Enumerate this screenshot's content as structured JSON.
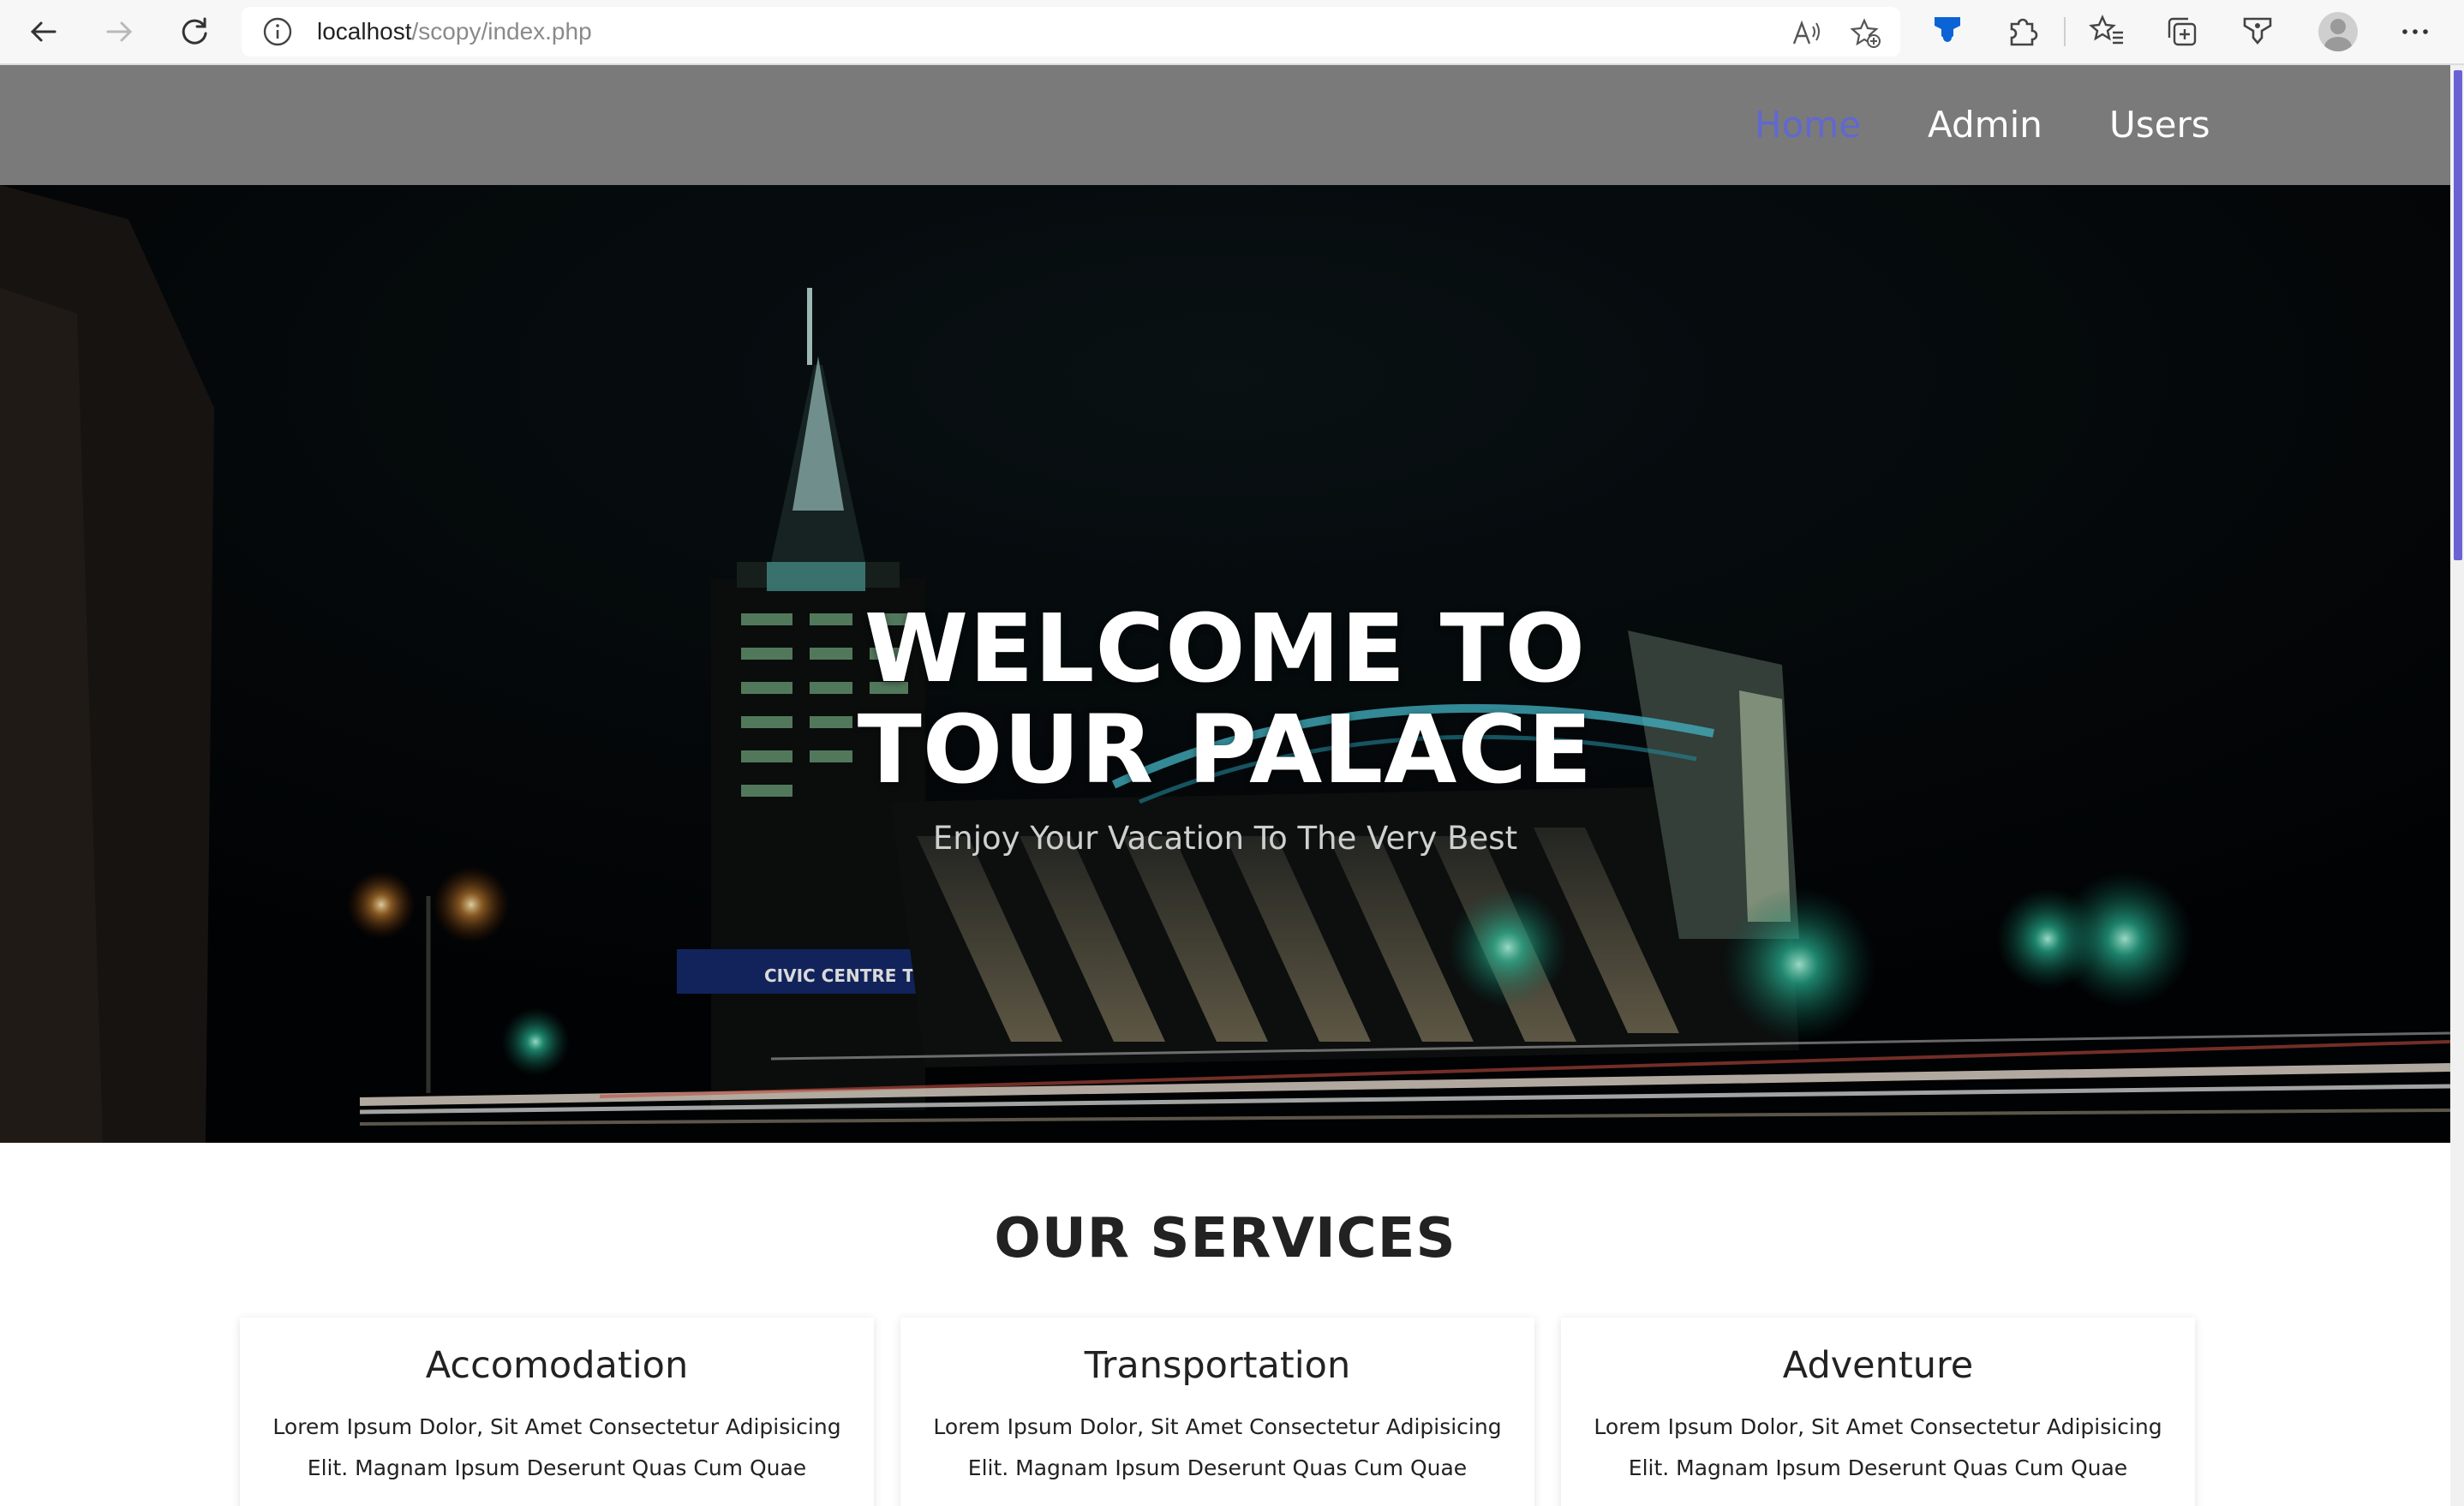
{
  "browser": {
    "url_host": "localhost",
    "url_path": "/scopy/index.php",
    "icons": [
      "back-icon",
      "forward-icon",
      "reload-icon",
      "site-info-icon",
      "read-aloud-icon",
      "add-favorite-icon",
      "extension-shield-icon",
      "extensions-icon",
      "favorites-icon",
      "collections-icon",
      "browser-essentials-icon",
      "profile-avatar-icon",
      "more-menu-icon"
    ]
  },
  "site": {
    "nav": [
      {
        "label": "Home",
        "active": true
      },
      {
        "label": "Admin",
        "active": false
      },
      {
        "label": "Users",
        "active": false
      }
    ],
    "hero": {
      "title": "WELCOME TO TOUR PALACE",
      "subtitle": "Enjoy Your Vacation To The Very Best",
      "sign_text": "CIVIC  CENTRE  TOWERS"
    },
    "services": {
      "title": "OUR SERVICES",
      "cards": [
        {
          "title": "Accomodation",
          "text": "Lorem Ipsum Dolor, Sit Amet Consectetur Adipisicing Elit. Magnam Ipsum Deserunt Quas Cum Quae"
        },
        {
          "title": "Transportation",
          "text": "Lorem Ipsum Dolor, Sit Amet Consectetur Adipisicing Elit. Magnam Ipsum Deserunt Quas Cum Quae"
        },
        {
          "title": "Adventure",
          "text": "Lorem Ipsum Dolor, Sit Amet Consectetur Adipisicing Elit. Magnam Ipsum Deserunt Quas Cum Quae"
        }
      ]
    }
  },
  "colors": {
    "header_bg": "#7a7a7a",
    "nav_active": "#6068d0",
    "nav_text": "#ffffff",
    "scroll_thumb": "#6a62d2"
  }
}
